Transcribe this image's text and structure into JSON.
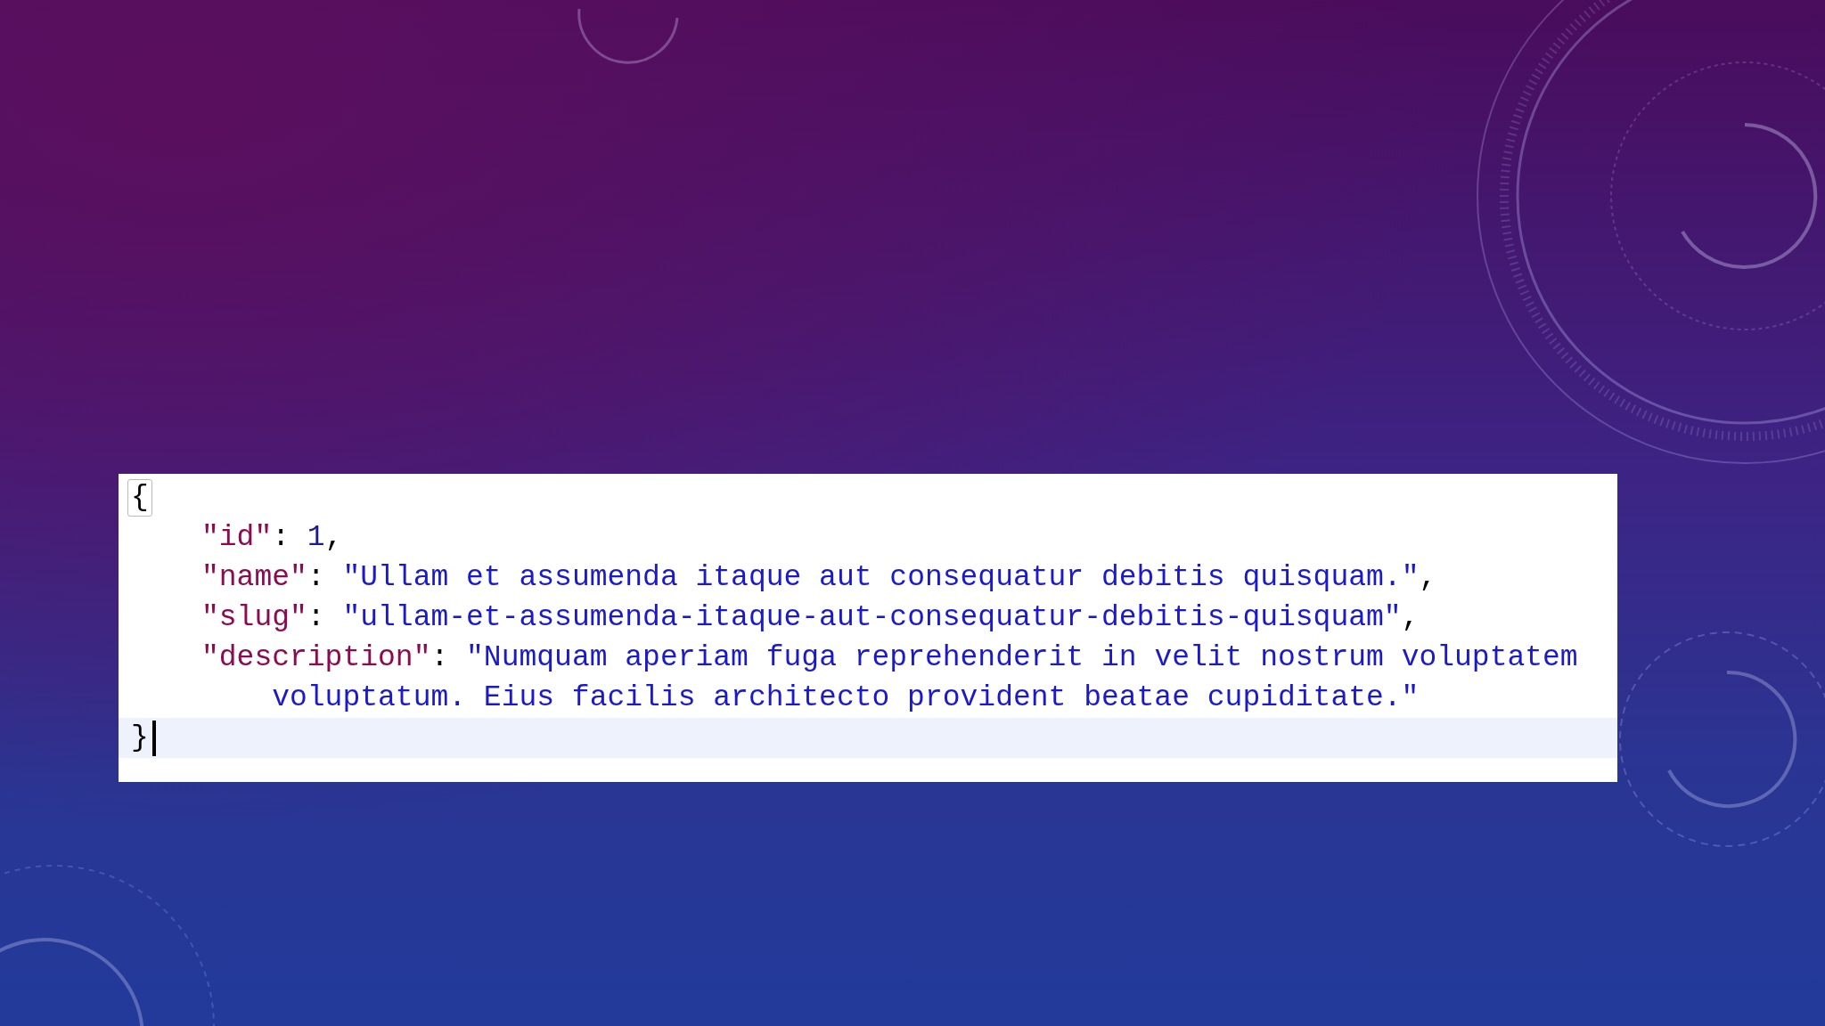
{
  "editor": {
    "open_brace": "{",
    "close_brace": "}",
    "bracket_match": true,
    "cursor_line_highlight": true,
    "entries": [
      {
        "key": "\"id\"",
        "separator": ": ",
        "value": "1",
        "kind": "number",
        "trailing": ","
      },
      {
        "key": "\"name\"",
        "separator": ": ",
        "value": "\"Ullam et assumenda itaque aut consequatur debitis quisquam.\"",
        "kind": "string",
        "trailing": ","
      },
      {
        "key": "\"slug\"",
        "separator": ": ",
        "value": "\"ullam-et-assumenda-itaque-aut-consequatur-debitis-quisquam\"",
        "kind": "string",
        "trailing": ","
      },
      {
        "key": "\"description\"",
        "separator": ": ",
        "value": "\"Numquam aperiam fuga reprehenderit in velit nostrum voluptatem voluptatum. Eius facilis architecto provident beatae cupiditate.\"",
        "kind": "string"
      }
    ]
  }
}
